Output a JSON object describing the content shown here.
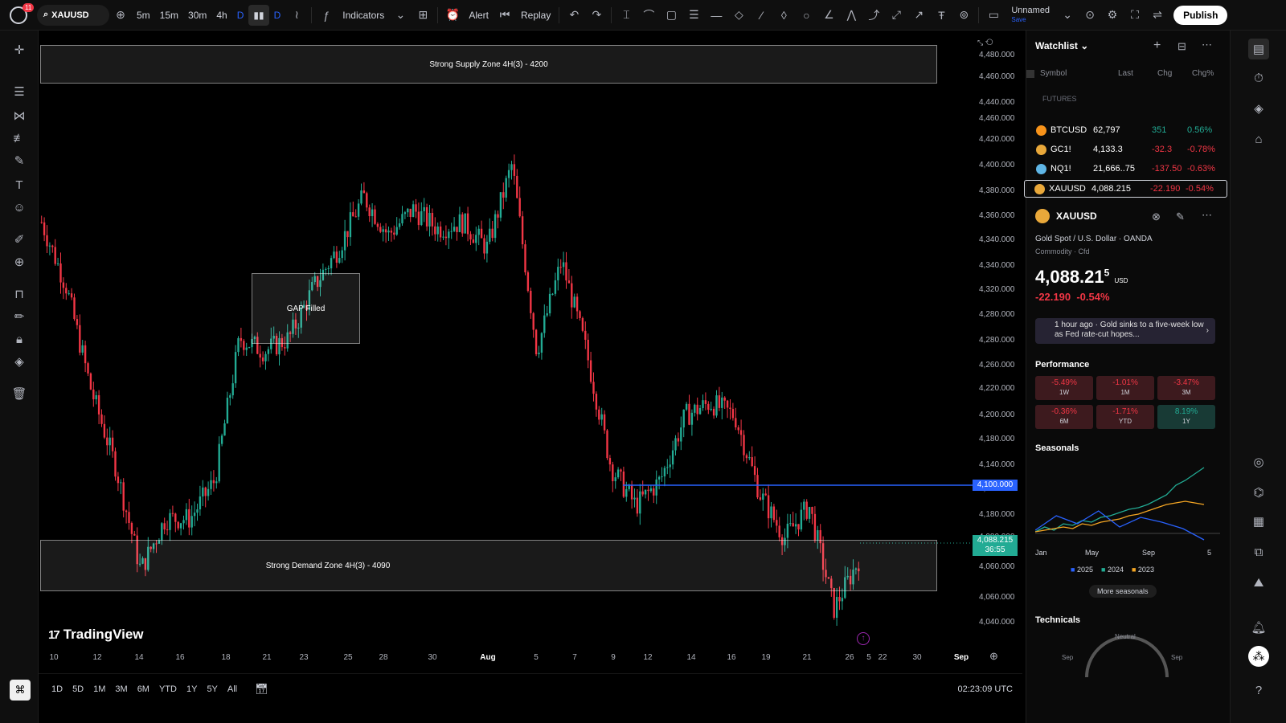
{
  "topbar": {
    "notif_count": "11",
    "symbol": "XAUUSD",
    "intervals": [
      "5m",
      "15m",
      "30m",
      "4h",
      "D",
      "D"
    ],
    "indicators_label": "Indicators",
    "alert_label": "Alert",
    "replay_label": "Replay",
    "layout_name": "Unnamed",
    "save_label": "Save",
    "publish_label": "Publish"
  },
  "chart": {
    "supply_zone_label": "Strong Supply Zone 4H(3) - 4200",
    "demand_zone_label": "Strong Demand Zone 4H(3) - 4090",
    "gap_label": "GAP Filled",
    "hline_price": "4,100.000",
    "last_price": "4,088.215",
    "countdown": "36:55",
    "brand": "TradingView",
    "price_axis": [
      "4,480.000",
      "4,460.000",
      "4,440.000",
      "4,460.000",
      "4,420.000",
      "4,400.000",
      "4,380.000",
      "4,360.000",
      "4,340.000",
      "4,340.000",
      "4,320.000",
      "4,280.000",
      "4,280.000",
      "4,260.000",
      "4,220.000",
      "4,200.000",
      "4,180.000",
      "4,140.000",
      "4,120.000",
      "4,180.000",
      "4,080.000",
      "4,060.000",
      "4,060.000",
      "4,040.000"
    ],
    "date_axis": [
      "10",
      "12",
      "14",
      "16",
      "18",
      "21",
      "23",
      "25",
      "28",
      "30",
      "Aug",
      "5",
      "7",
      "9",
      "12",
      "14",
      "16",
      "19",
      "21",
      "26",
      "5",
      "22",
      "30",
      "Sep"
    ]
  },
  "chart_data": {
    "type": "candlestick",
    "symbol": "XAUUSD",
    "annotations": [
      "Strong Supply Zone 4H(3) - 4200",
      "Strong Demand Zone 4H(3) - 4090",
      "GAP Filled"
    ],
    "horizontal_line": 4100,
    "last": 4088.215,
    "close_path": [
      4350,
      4300,
      4220,
      4160,
      4080,
      4120,
      4120,
      4150,
      4260,
      4250,
      4260,
      4300,
      4330,
      4370,
      4340,
      4360,
      4345,
      4350,
      4330,
      4395,
      4250,
      4320,
      4250,
      4160,
      4130,
      4150,
      4200,
      4210,
      4200,
      4140,
      4105,
      4130,
      4050,
      4088
    ]
  },
  "bottombar": {
    "ranges": [
      "1D",
      "5D",
      "1M",
      "3M",
      "6M",
      "YTD",
      "1Y",
      "5Y",
      "All"
    ],
    "time": "02:23:09 UTC"
  },
  "watchlist": {
    "title": "Watchlist",
    "columns": [
      "Symbol",
      "Last",
      "Chg",
      "Chg%"
    ],
    "section": "FUTURES",
    "rows": [
      {
        "symbol": "BTCUSD",
        "last": "62,797",
        "chg": "351",
        "chgp": "0.56%",
        "dir": "up",
        "color": "#f7931a"
      },
      {
        "symbol": "GC1!",
        "last": "4,133.3",
        "chg": "-32.3",
        "chgp": "-0.78%",
        "dir": "down",
        "color": "#e9a83a"
      },
      {
        "symbol": "NQ1!",
        "last": "21,666..75",
        "chg": "-137.50",
        "chgp": "-0.63%",
        "dir": "down",
        "color": "#5fb6e6"
      },
      {
        "symbol": "XAUUSD",
        "last": "4,088.215",
        "chg": "-22.190",
        "chgp": "-0.54%",
        "dir": "down",
        "color": "#e9a83a"
      }
    ]
  },
  "details": {
    "symbol": "XAUUSD",
    "name": "Gold Spot / U.S. Dollar",
    "exchange": "OANDA",
    "type": "Commodity · Cfd",
    "price_main": "4,088.21",
    "price_sup": "5",
    "currency": "USD",
    "change": "-22.190",
    "change_pct": "-0.54%",
    "news": "1 hour ago · Gold sinks to a five-week low as Fed rate-cut hopes...",
    "performance_title": "Performance",
    "performance": [
      {
        "value": "-5.49%",
        "label": "1W",
        "dir": "down"
      },
      {
        "value": "-1.01%",
        "label": "1M",
        "dir": "down"
      },
      {
        "value": "-3.47%",
        "label": "3M",
        "dir": "down"
      },
      {
        "value": "-0.36%",
        "label": "6M",
        "dir": "down"
      },
      {
        "value": "-1.71%",
        "label": "YTD",
        "dir": "down"
      },
      {
        "value": "8.19%",
        "label": "1Y",
        "dir": "up"
      }
    ],
    "seasonals_title": "Seasonals",
    "seasonals_months": [
      "Jan",
      "May",
      "Sep",
      "5"
    ],
    "seasonals_legend": [
      "2025",
      "2024",
      "2023"
    ],
    "more_seasonals": "More seasonals",
    "technicals_title": "Technicals",
    "technicals_gauge": [
      "Sep",
      "Neutral",
      "Sep"
    ]
  },
  "colors": {
    "up": "#22ab94",
    "down": "#f23645",
    "accent": "#2962ff"
  }
}
